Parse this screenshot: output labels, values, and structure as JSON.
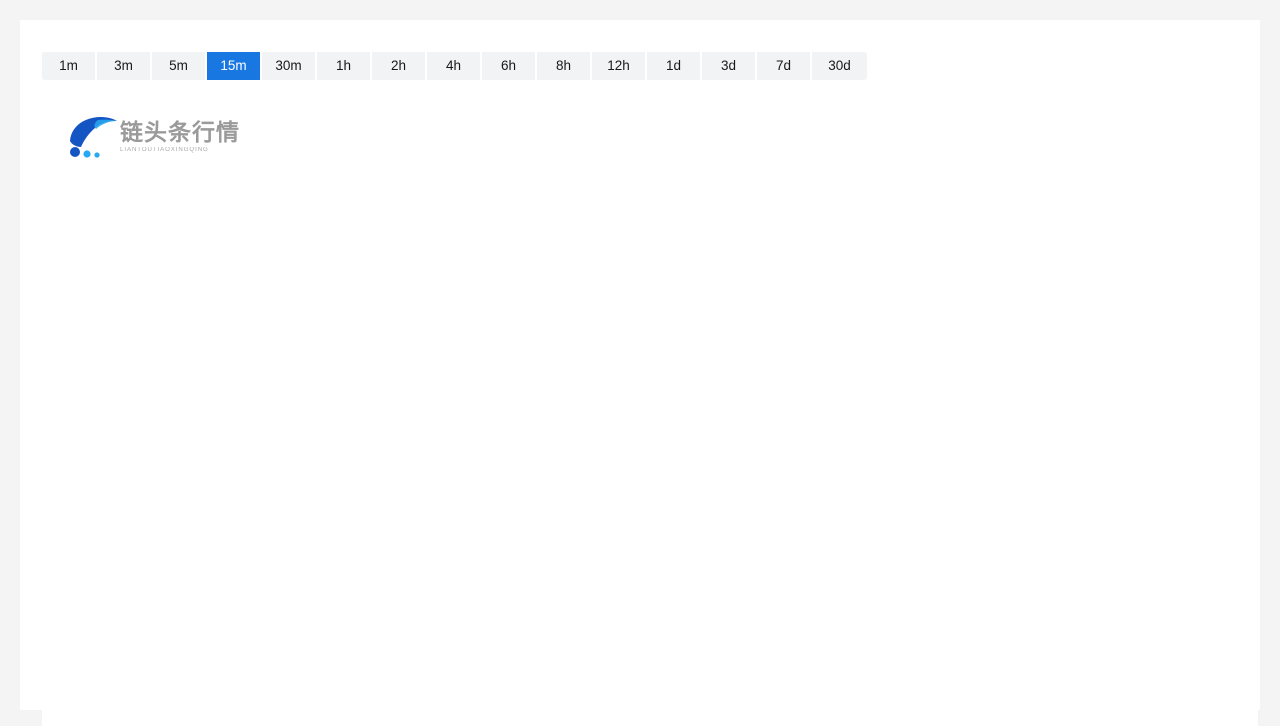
{
  "timeframe_bar": {
    "selected": "15m",
    "items": [
      {
        "label": "1m"
      },
      {
        "label": "3m"
      },
      {
        "label": "5m"
      },
      {
        "label": "15m"
      },
      {
        "label": "30m"
      },
      {
        "label": "1h"
      },
      {
        "label": "2h"
      },
      {
        "label": "4h"
      },
      {
        "label": "6h"
      },
      {
        "label": "8h"
      },
      {
        "label": "12h"
      },
      {
        "label": "1d"
      },
      {
        "label": "3d"
      },
      {
        "label": "7d"
      },
      {
        "label": "30d"
      }
    ],
    "active_background": "#1877e0",
    "active_text_color": "#ffffff",
    "inactive_background": "#f2f3f5",
    "inactive_text_color": "#16181c"
  },
  "logo": {
    "icon_name": "comet-swoosh-logo-icon",
    "title_cn": "链头条行情",
    "subtitle_pinyin": "LIANTOUTIAOXINGQING",
    "mark_color_dark": "#1455c4",
    "mark_color_light": "#28a8f0",
    "text_color": "#9a9a9a"
  },
  "chart": {
    "state_label": "",
    "background": "#ffffff"
  },
  "theme": {
    "page_background": "#f4f4f5",
    "card_background": "#ffffff"
  }
}
